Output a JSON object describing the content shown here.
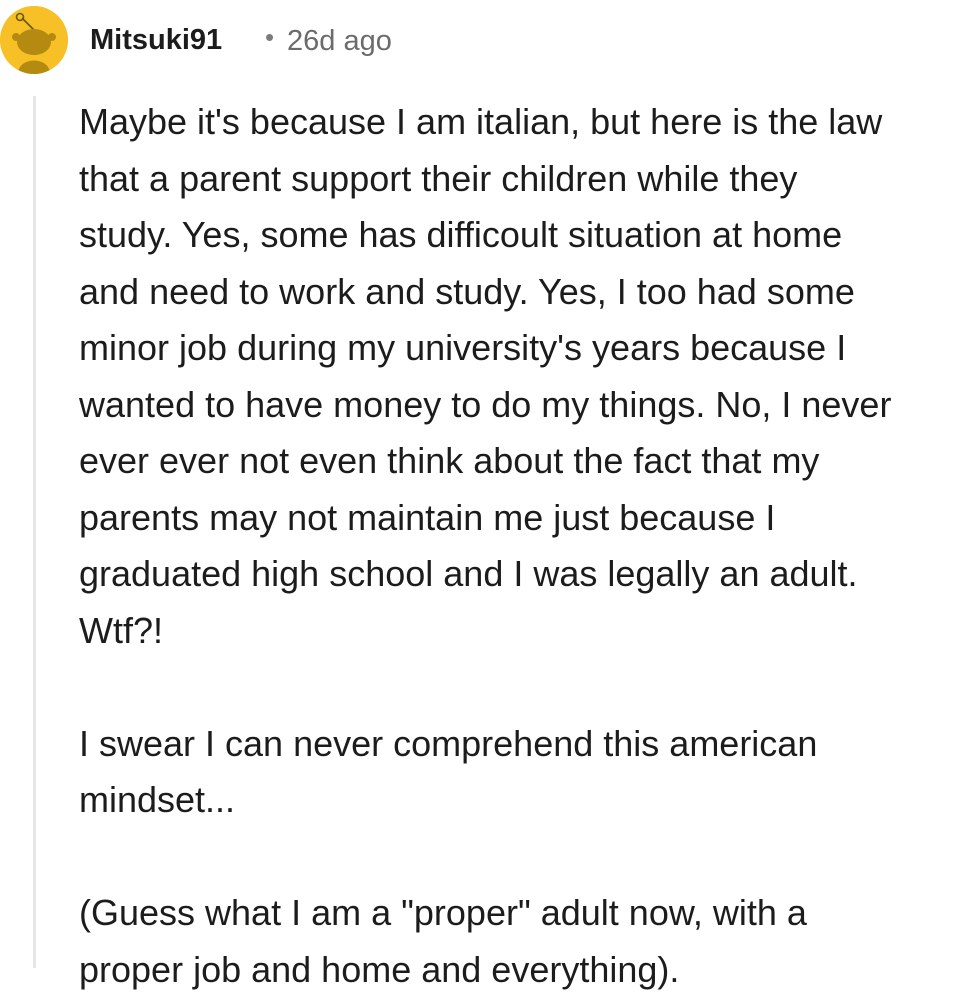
{
  "comment": {
    "author": "Mitsuki91",
    "separator": "•",
    "timestamp": "26d ago",
    "avatar_icon": "reddit-snoo-avatar-icon",
    "avatar_color": "#f6c026",
    "paragraphs": [
      "Maybe it's because I am italian, but here is the law\nthat a parent support their children while they\nstudy. Yes, some has difficoult situation at home\nand need to work and study. Yes, I too had some\nminor job during my university's years because I\nwanted to have money to do my things. No, I never\never ever not even think about the fact that my\nparents may not maintain me just because I\ngraduated high school and I was legally an adult.\nWtf?!",
      "I swear I can never comprehend this american\nmindset...",
      "(Guess what I am a \"proper\" adult now, with a\nproper job and home and everything)."
    ]
  }
}
